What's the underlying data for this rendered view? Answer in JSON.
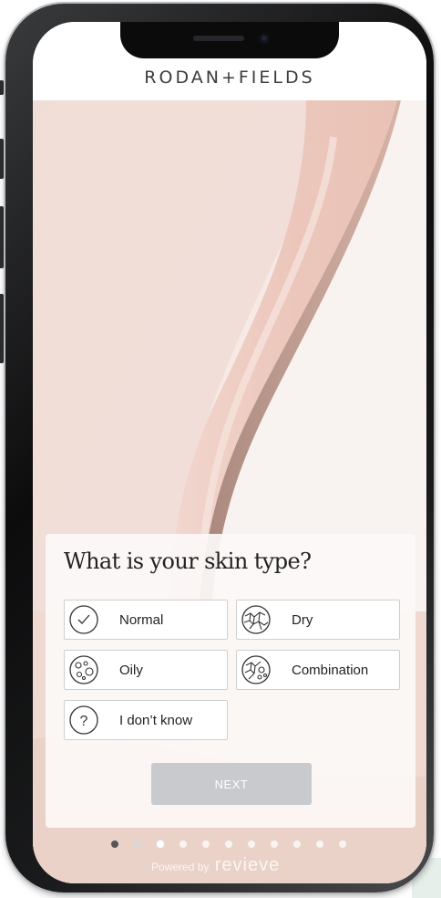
{
  "brand": "RODAN+FIELDS",
  "question": "What is your skin type?",
  "options": [
    {
      "label": "Normal",
      "icon": "check-circle-icon"
    },
    {
      "label": "Dry",
      "icon": "dry-skin-icon"
    },
    {
      "label": "Oily",
      "icon": "oily-skin-icon"
    },
    {
      "label": "Combination",
      "icon": "combination-skin-icon"
    },
    {
      "label": "I don’t know",
      "icon": "question-circle-icon"
    }
  ],
  "next_label": "NEXT",
  "pagination": {
    "total": 11,
    "current": 3
  },
  "powered_by": {
    "text": "Powered by",
    "logo": "revieve"
  },
  "colors": {
    "accent": "#c9cacd",
    "background": "#f9f1ef",
    "text": "#222222"
  }
}
